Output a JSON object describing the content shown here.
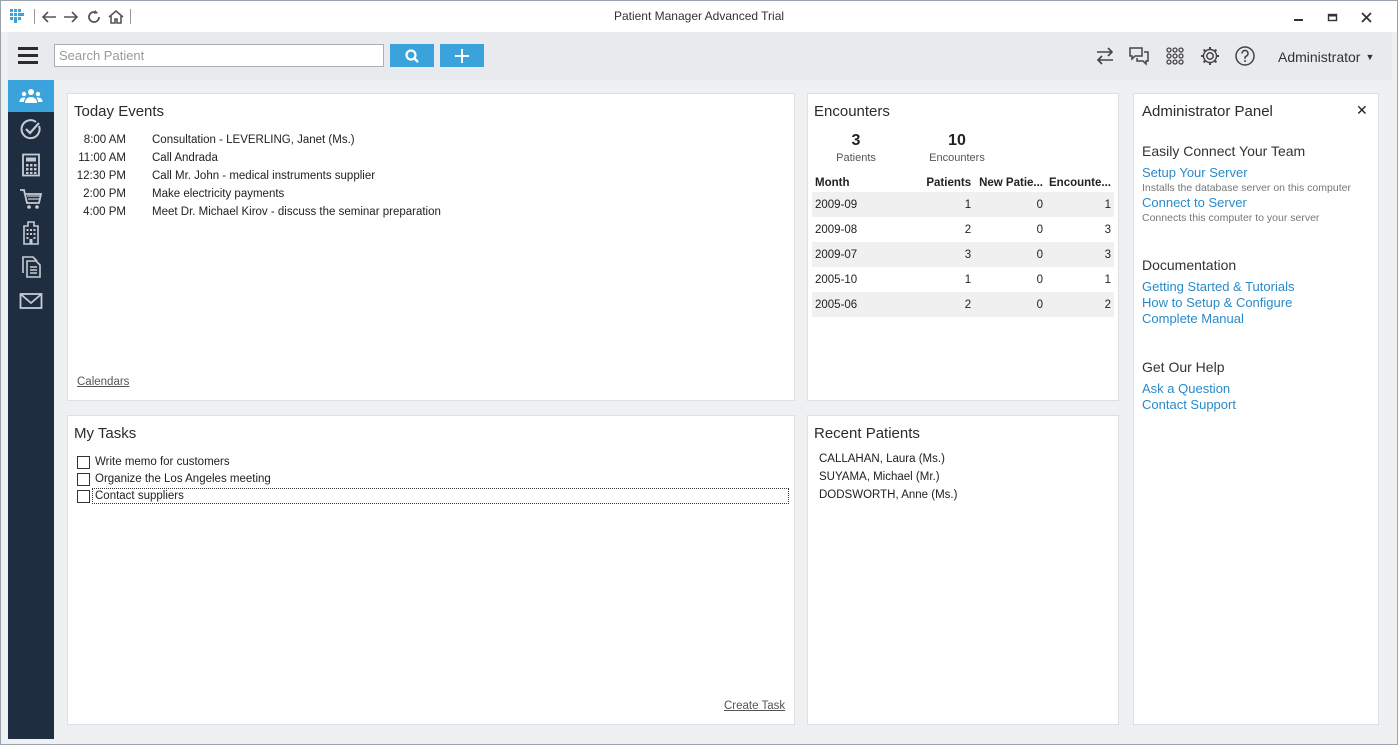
{
  "window": {
    "title": "Patient Manager Advanced Trial"
  },
  "toolbar": {
    "search_placeholder": "Search Patient",
    "user_menu_label": "Administrator"
  },
  "colors": {
    "accent": "#3aa3dc",
    "sidebar_bg": "#1f2d40",
    "link": "#2a8ac8"
  },
  "sidebar": {
    "items": [
      {
        "icon": "patients-icon",
        "active": true
      },
      {
        "icon": "tasks-check-icon",
        "active": false
      },
      {
        "icon": "calculator-icon",
        "active": false
      },
      {
        "icon": "cart-icon",
        "active": false
      },
      {
        "icon": "building-icon",
        "active": false
      },
      {
        "icon": "documents-icon",
        "active": false
      },
      {
        "icon": "mail-icon",
        "active": false
      }
    ]
  },
  "today_events": {
    "title": "Today Events",
    "events": [
      {
        "time": "8:00 AM",
        "text": "Consultation - LEVERLING, Janet (Ms.)"
      },
      {
        "time": "11:00 AM",
        "text": "Call Andrada"
      },
      {
        "time": "12:30 PM",
        "text": "Call Mr. John - medical instruments supplier"
      },
      {
        "time": "2:00 PM",
        "text": "Make electricity payments"
      },
      {
        "time": "4:00 PM",
        "text": "Meet Dr. Michael Kirov - discuss the seminar preparation"
      }
    ],
    "calendars_link": "Calendars"
  },
  "my_tasks": {
    "title": "My Tasks",
    "tasks": [
      {
        "label": "Write memo for customers",
        "checked": false
      },
      {
        "label": "Organize the Los Angeles meeting",
        "checked": false
      },
      {
        "label": "Contact suppliers",
        "checked": false
      }
    ],
    "create_link": "Create Task"
  },
  "encounters": {
    "title": "Encounters",
    "patients_count": "3",
    "patients_label": "Patients",
    "encounters_count": "10",
    "encounters_label": "Encounters",
    "columns": [
      "Month",
      "Patients",
      "New Patie...",
      "Encounte..."
    ],
    "rows": [
      [
        "2009-09",
        "1",
        "0",
        "1"
      ],
      [
        "2009-08",
        "2",
        "0",
        "3"
      ],
      [
        "2009-07",
        "3",
        "0",
        "3"
      ],
      [
        "2005-10",
        "1",
        "0",
        "1"
      ],
      [
        "2005-06",
        "2",
        "0",
        "2"
      ]
    ]
  },
  "recent_patients": {
    "title": "Recent Patients",
    "patients": [
      "CALLAHAN, Laura (Ms.)",
      "SUYAMA, Michael (Mr.)",
      "DODSWORTH, Anne (Ms.)"
    ]
  },
  "admin_panel": {
    "title": "Administrator Panel",
    "close": "✕",
    "team_heading": "Easily Connect Your Team",
    "setup_server": "Setup Your Server",
    "setup_server_desc": "Installs the database server on this computer",
    "connect_server": "Connect to Server",
    "connect_server_desc": "Connects this computer to your server",
    "docs_heading": "Documentation",
    "getting_started": "Getting Started & Tutorials",
    "how_to_setup": "How to Setup & Configure",
    "manual": "Complete Manual",
    "help_heading": "Get Our Help",
    "ask_question": "Ask a Question",
    "contact_support": "Contact Support"
  }
}
